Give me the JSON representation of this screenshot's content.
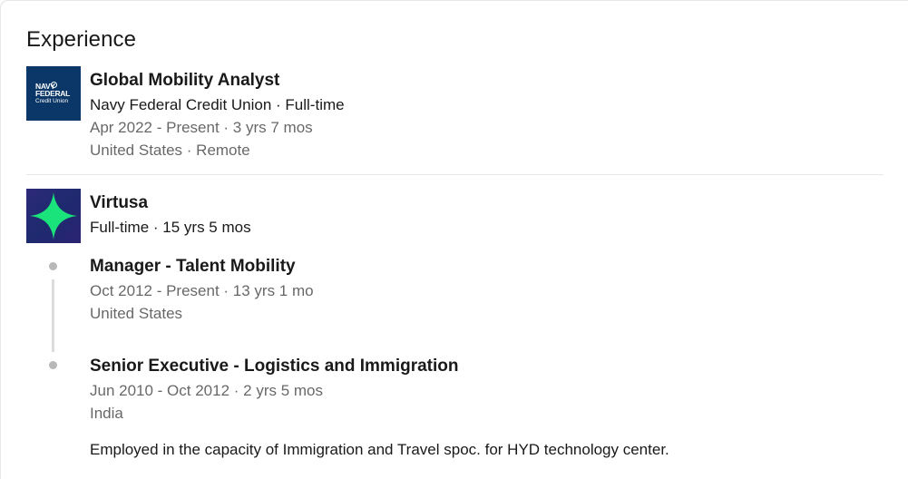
{
  "section": {
    "title": "Experience"
  },
  "experiences": [
    {
      "logo": "navy-federal-logo",
      "logo_text": [
        "NAVY",
        "FEDERAL",
        "Credit Union"
      ],
      "title": "Global Mobility Analyst",
      "company": "Navy Federal Credit Union · Full-time",
      "dates": "Apr 2022 - Present · 3 yrs 7 mos",
      "location": "United States · Remote"
    },
    {
      "logo": "virtusa-logo",
      "company": "Virtusa",
      "tenure": "Full-time · 15 yrs 5 mos",
      "roles": [
        {
          "title": "Manager - Talent Mobility",
          "dates": "Oct 2012 - Present · 13 yrs 1 mo",
          "location": "United States"
        },
        {
          "title": "Senior Executive - Logistics and Immigration",
          "dates": "Jun 2010 - Oct 2012 · 2 yrs 5 mos",
          "location": "India",
          "description": "Employed in the capacity of Immigration and Travel spoc. for HYD technology center."
        }
      ]
    }
  ],
  "colors": {
    "navy_federal_bg": "#0b3768",
    "virtusa_bg": "#2b2373",
    "virtusa_star": "#19e37a",
    "divider": "#e8e8e8",
    "timeline": "#b8b8b8"
  }
}
